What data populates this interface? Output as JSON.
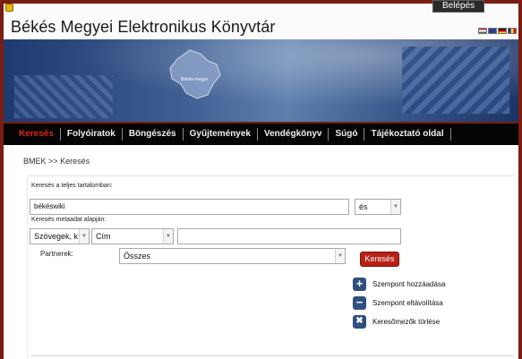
{
  "header": {
    "title": "Békés Megyei Elektronikus Könyvtár",
    "login_label": "Belépés",
    "flags": [
      "hungarian-flag-icon",
      "english-flag-icon",
      "german-flag-icon",
      "romanian-flag-icon"
    ]
  },
  "banner": {
    "map_label": "Békés megye"
  },
  "nav": {
    "items": [
      "Keresés",
      "Folyóiratok",
      "Böngészés",
      "Gyűjtemények",
      "Vendégkönyv",
      "Súgó",
      "Tájékoztató oldal"
    ],
    "active": "Keresés"
  },
  "breadcrumb": {
    "home": "BMEK",
    "separator": ">>",
    "current": "Keresés"
  },
  "search": {
    "fulltext_label": "Keresés a teljes tartalomban:",
    "fulltext_value": "békéswiki",
    "operator": "és",
    "metadata_label": "Keresés metaadat alapján:",
    "type_select": "Szövegek, k",
    "field_select": "Cím",
    "metadata_value": "",
    "partners_label": "Partnerek:",
    "partners_select": "Összes",
    "search_button": "Keresés"
  },
  "actions": {
    "add_criterion": "Szempont hozzáadása",
    "remove_criterion": "Szempont eltávolítása",
    "clear_fields": "Keresőmezők törlése"
  },
  "colors": {
    "frame": "#7a1d12",
    "nav_bg": "#050505",
    "nav_active": "#d9261a",
    "button": "#b82116",
    "action_icon": "#2f4f7e"
  }
}
